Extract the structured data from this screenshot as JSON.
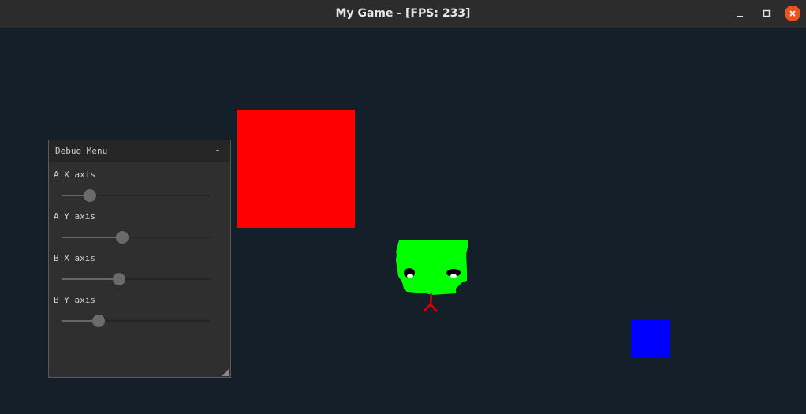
{
  "window": {
    "title": "My Game - [FPS: 233]",
    "minimize_icon": "minimize-icon",
    "maximize_icon": "maximize-icon",
    "close_icon": "close-icon",
    "accent_close": "#e95420"
  },
  "scene": {
    "background": "#141f2a",
    "red_square_color": "#ff0000",
    "blue_square_color": "#0000ff",
    "character_color": "#00ff00"
  },
  "debug_menu": {
    "title": "Debug Menu",
    "collapse_label": "-",
    "sliders": [
      {
        "label": "A X axis",
        "value": 0.19
      },
      {
        "label": "A Y axis",
        "value": 0.41
      },
      {
        "label": "B X axis",
        "value": 0.39
      },
      {
        "label": "B Y axis",
        "value": 0.25
      }
    ]
  }
}
